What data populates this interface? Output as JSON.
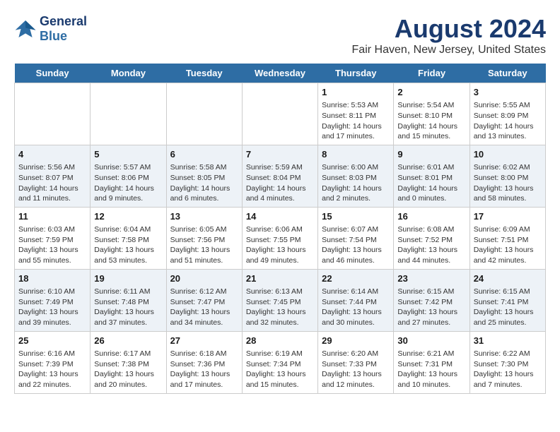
{
  "header": {
    "logo_line1": "General",
    "logo_line2": "Blue",
    "month": "August 2024",
    "location": "Fair Haven, New Jersey, United States"
  },
  "weekdays": [
    "Sunday",
    "Monday",
    "Tuesday",
    "Wednesday",
    "Thursday",
    "Friday",
    "Saturday"
  ],
  "weeks": [
    [
      {
        "day": "",
        "info": ""
      },
      {
        "day": "",
        "info": ""
      },
      {
        "day": "",
        "info": ""
      },
      {
        "day": "",
        "info": ""
      },
      {
        "day": "1",
        "info": "Sunrise: 5:53 AM\nSunset: 8:11 PM\nDaylight: 14 hours and 17 minutes."
      },
      {
        "day": "2",
        "info": "Sunrise: 5:54 AM\nSunset: 8:10 PM\nDaylight: 14 hours and 15 minutes."
      },
      {
        "day": "3",
        "info": "Sunrise: 5:55 AM\nSunset: 8:09 PM\nDaylight: 14 hours and 13 minutes."
      }
    ],
    [
      {
        "day": "4",
        "info": "Sunrise: 5:56 AM\nSunset: 8:07 PM\nDaylight: 14 hours and 11 minutes."
      },
      {
        "day": "5",
        "info": "Sunrise: 5:57 AM\nSunset: 8:06 PM\nDaylight: 14 hours and 9 minutes."
      },
      {
        "day": "6",
        "info": "Sunrise: 5:58 AM\nSunset: 8:05 PM\nDaylight: 14 hours and 6 minutes."
      },
      {
        "day": "7",
        "info": "Sunrise: 5:59 AM\nSunset: 8:04 PM\nDaylight: 14 hours and 4 minutes."
      },
      {
        "day": "8",
        "info": "Sunrise: 6:00 AM\nSunset: 8:03 PM\nDaylight: 14 hours and 2 minutes."
      },
      {
        "day": "9",
        "info": "Sunrise: 6:01 AM\nSunset: 8:01 PM\nDaylight: 14 hours and 0 minutes."
      },
      {
        "day": "10",
        "info": "Sunrise: 6:02 AM\nSunset: 8:00 PM\nDaylight: 13 hours and 58 minutes."
      }
    ],
    [
      {
        "day": "11",
        "info": "Sunrise: 6:03 AM\nSunset: 7:59 PM\nDaylight: 13 hours and 55 minutes."
      },
      {
        "day": "12",
        "info": "Sunrise: 6:04 AM\nSunset: 7:58 PM\nDaylight: 13 hours and 53 minutes."
      },
      {
        "day": "13",
        "info": "Sunrise: 6:05 AM\nSunset: 7:56 PM\nDaylight: 13 hours and 51 minutes."
      },
      {
        "day": "14",
        "info": "Sunrise: 6:06 AM\nSunset: 7:55 PM\nDaylight: 13 hours and 49 minutes."
      },
      {
        "day": "15",
        "info": "Sunrise: 6:07 AM\nSunset: 7:54 PM\nDaylight: 13 hours and 46 minutes."
      },
      {
        "day": "16",
        "info": "Sunrise: 6:08 AM\nSunset: 7:52 PM\nDaylight: 13 hours and 44 minutes."
      },
      {
        "day": "17",
        "info": "Sunrise: 6:09 AM\nSunset: 7:51 PM\nDaylight: 13 hours and 42 minutes."
      }
    ],
    [
      {
        "day": "18",
        "info": "Sunrise: 6:10 AM\nSunset: 7:49 PM\nDaylight: 13 hours and 39 minutes."
      },
      {
        "day": "19",
        "info": "Sunrise: 6:11 AM\nSunset: 7:48 PM\nDaylight: 13 hours and 37 minutes."
      },
      {
        "day": "20",
        "info": "Sunrise: 6:12 AM\nSunset: 7:47 PM\nDaylight: 13 hours and 34 minutes."
      },
      {
        "day": "21",
        "info": "Sunrise: 6:13 AM\nSunset: 7:45 PM\nDaylight: 13 hours and 32 minutes."
      },
      {
        "day": "22",
        "info": "Sunrise: 6:14 AM\nSunset: 7:44 PM\nDaylight: 13 hours and 30 minutes."
      },
      {
        "day": "23",
        "info": "Sunrise: 6:15 AM\nSunset: 7:42 PM\nDaylight: 13 hours and 27 minutes."
      },
      {
        "day": "24",
        "info": "Sunrise: 6:15 AM\nSunset: 7:41 PM\nDaylight: 13 hours and 25 minutes."
      }
    ],
    [
      {
        "day": "25",
        "info": "Sunrise: 6:16 AM\nSunset: 7:39 PM\nDaylight: 13 hours and 22 minutes."
      },
      {
        "day": "26",
        "info": "Sunrise: 6:17 AM\nSunset: 7:38 PM\nDaylight: 13 hours and 20 minutes."
      },
      {
        "day": "27",
        "info": "Sunrise: 6:18 AM\nSunset: 7:36 PM\nDaylight: 13 hours and 17 minutes."
      },
      {
        "day": "28",
        "info": "Sunrise: 6:19 AM\nSunset: 7:34 PM\nDaylight: 13 hours and 15 minutes."
      },
      {
        "day": "29",
        "info": "Sunrise: 6:20 AM\nSunset: 7:33 PM\nDaylight: 13 hours and 12 minutes."
      },
      {
        "day": "30",
        "info": "Sunrise: 6:21 AM\nSunset: 7:31 PM\nDaylight: 13 hours and 10 minutes."
      },
      {
        "day": "31",
        "info": "Sunrise: 6:22 AM\nSunset: 7:30 PM\nDaylight: 13 hours and 7 minutes."
      }
    ]
  ]
}
